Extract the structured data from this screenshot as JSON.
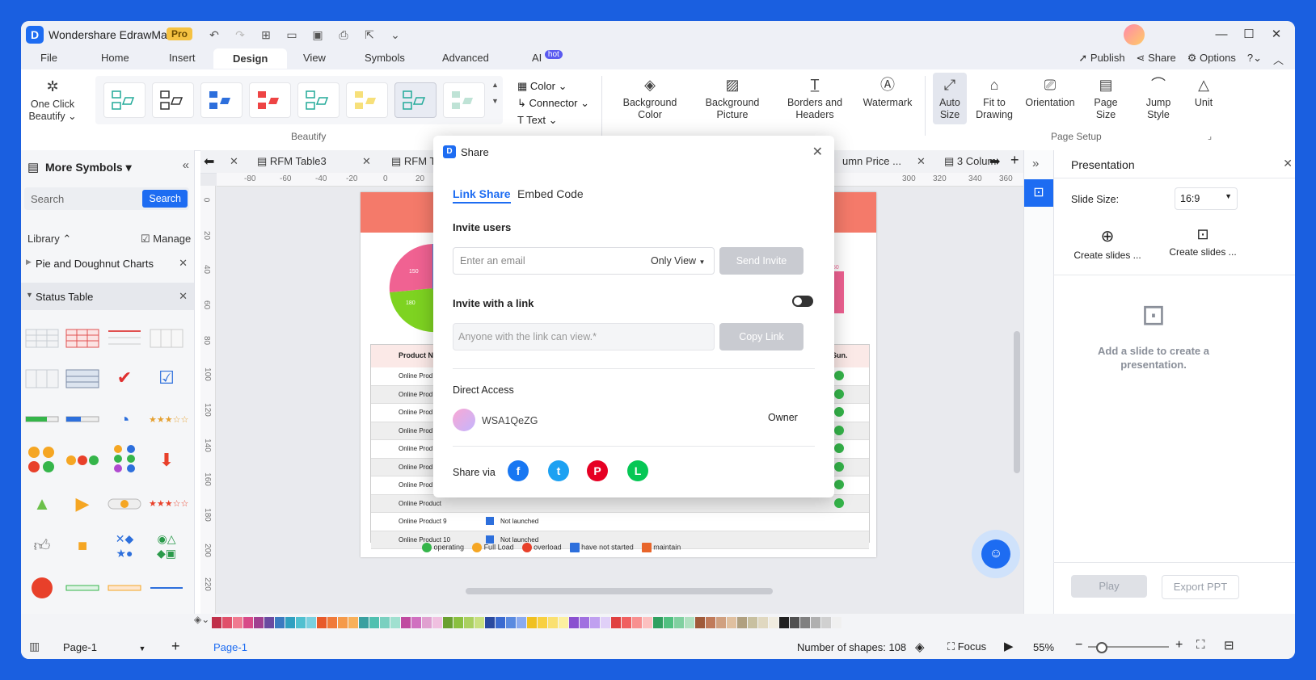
{
  "app": {
    "title": "Wondershare EdrawMax",
    "badge": "Pro"
  },
  "menu_tabs": [
    "File",
    "Home",
    "Insert",
    "Design",
    "View",
    "Symbols",
    "Advanced",
    "AI"
  ],
  "ai_badge": "hot",
  "top_right": {
    "publish": "Publish",
    "share": "Share",
    "options": "Options"
  },
  "ribbon": {
    "one_click": "One Click Beautify",
    "beautify_group": "Beautify",
    "color": "Color",
    "connector": "Connector",
    "text": "Text",
    "background_color": "Background Color",
    "background_picture": "Background Picture",
    "borders_headers": "Borders and Headers",
    "watermark": "Watermark",
    "auto_size": "Auto Size",
    "fit_to_drawing": "Fit to Drawing",
    "orientation": "Orientation",
    "page_size": "Page Size",
    "jump_style": "Jump Style",
    "unit": "Unit",
    "page_setup_group": "Page Setup"
  },
  "left_panel": {
    "title": "More Symbols",
    "search_placeholder": "Search",
    "search_button": "Search",
    "library": "Library",
    "manage": "Manage",
    "categories": [
      "Pie and Doughnut Charts",
      "Status Table"
    ]
  },
  "doc_tabs": [
    "RFM Table3",
    "RFM T",
    "umn Price ...",
    "3 Colum"
  ],
  "ruler_h": [
    "-80",
    "-60",
    "-40",
    "-20",
    "0",
    "20",
    "300",
    "320",
    "340",
    "360"
  ],
  "ruler_v": [
    "0",
    "20",
    "40",
    "60",
    "80",
    "100",
    "120",
    "140",
    "160",
    "180",
    "200",
    "220"
  ],
  "diagram": {
    "pie_labels": [
      "150",
      "180"
    ],
    "bar_label": "50",
    "header_first": "Product N",
    "header_last": "Sun.",
    "rows": [
      "Online Prod",
      "Online Prod",
      "Online Prod",
      "Online Prod",
      "Online Prod",
      "Online Prod",
      "Online Prod",
      "Online Product",
      "Online Product 9",
      "Online Product 10"
    ],
    "row9_status": "Not launched",
    "row10_status": "Not launched",
    "legend": [
      "operating",
      "Full Load",
      "overload",
      "have not started",
      "maintain"
    ]
  },
  "share_dialog": {
    "title": "Share",
    "tab_link": "Link Share",
    "tab_embed": "Embed Code",
    "invite_users": "Invite users",
    "email_placeholder": "Enter an email",
    "permission": "Only View",
    "send_invite": "Send Invite",
    "invite_link": "Invite with a link",
    "link_placeholder": "Anyone with the link can view.*",
    "copy_link": "Copy Link",
    "direct_access": "Direct Access",
    "user_name": "WSA1QeZG",
    "user_role": "Owner",
    "share_via": "Share via",
    "social": [
      "facebook-icon",
      "twitter-icon",
      "pinterest-icon",
      "line-icon"
    ]
  },
  "right_panel": {
    "title": "Presentation",
    "slide_size_label": "Slide Size:",
    "slide_size_value": "16:9",
    "create_slides_1": "Create slides ...",
    "create_slides_2": "Create slides ...",
    "empty_msg": "Add a slide to create a presentation.",
    "play": "Play",
    "export": "Export PPT"
  },
  "status": {
    "page_select": "Page-1",
    "page_tab": "Page-1",
    "shapes": "Number of shapes: 108",
    "focus": "Focus",
    "zoom": "55%"
  },
  "colors": {
    "accent": "#1d6cf2",
    "header_band": "#f47a6a",
    "status_green": "#35b54a"
  }
}
